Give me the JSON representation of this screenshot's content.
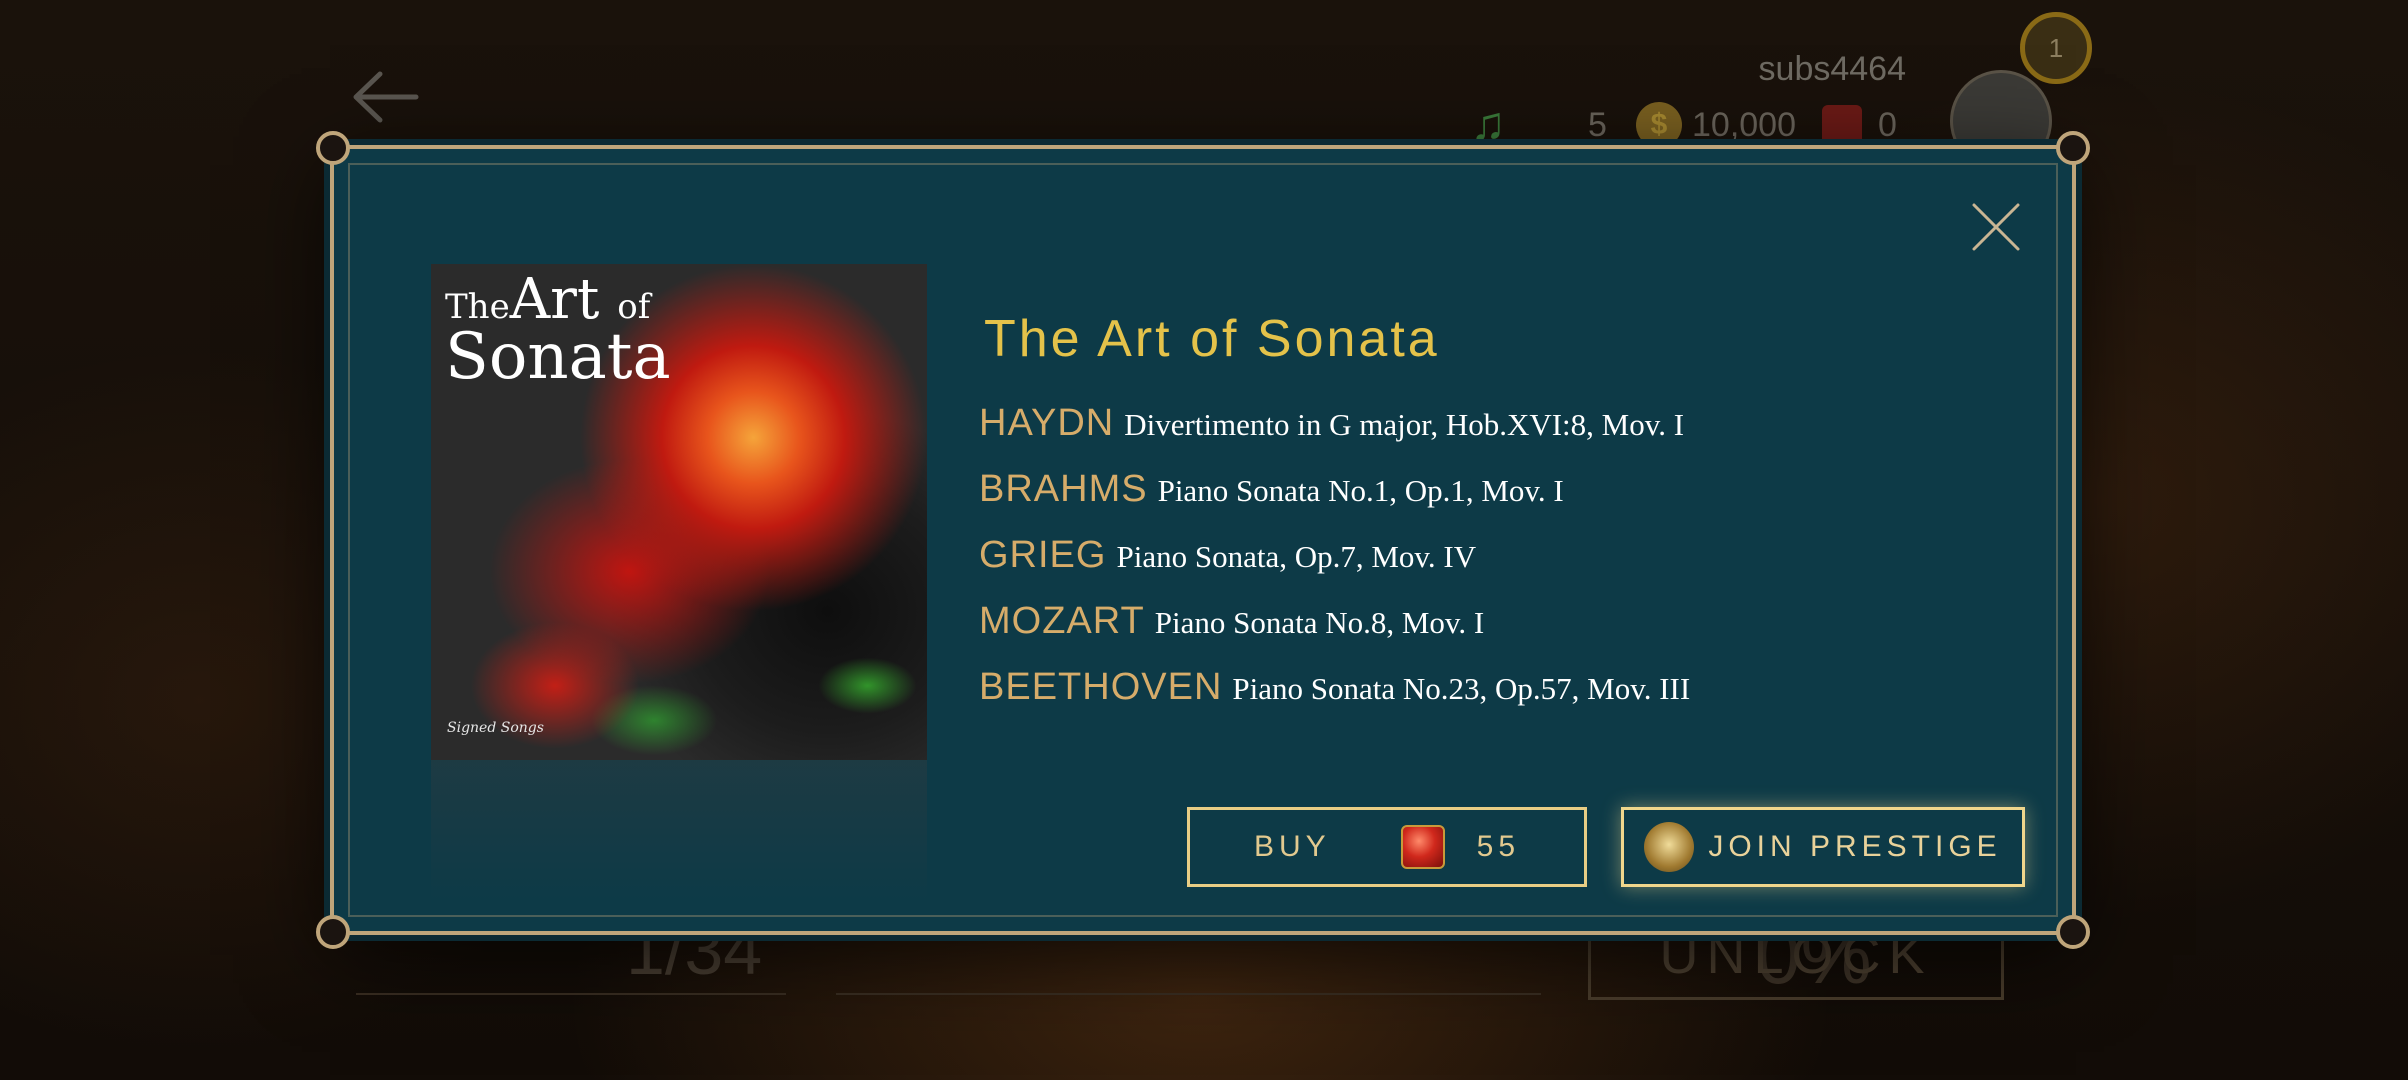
{
  "hud": {
    "username": "subs4464",
    "notes": "5",
    "coins": "10,000",
    "gems": "0",
    "level": "1"
  },
  "background": {
    "pager": "1/34",
    "percent": "0%",
    "unlock_label": "UNLOCK"
  },
  "modal": {
    "cover": {
      "title_the": "The",
      "title_art": "Art",
      "title_of": "of",
      "title_sonata": "Sonata",
      "credit": "Signed Songs"
    },
    "title": "The Art of Sonata",
    "tracks": [
      {
        "composer": "HAYDN",
        "piece": "Divertimento in G major, Hob.XVI:8, Mov. I"
      },
      {
        "composer": "BRAHMS",
        "piece": "Piano Sonata No.1, Op.1, Mov. I"
      },
      {
        "composer": "GRIEG",
        "piece": "Piano Sonata, Op.7, Mov. IV"
      },
      {
        "composer": "MOZART",
        "piece": "Piano Sonata No.8, Mov. I"
      },
      {
        "composer": "BEETHOVEN",
        "piece": "Piano Sonata No.23, Op.57, Mov. III"
      }
    ],
    "buy_label": "BUY",
    "buy_price": "55",
    "prestige_label": "JOIN PRESTIGE"
  },
  "icons": {
    "back": "back-arrow-icon",
    "note": "music-note-icon",
    "coin": "coin-icon",
    "gem": "ruby-gem-icon",
    "close": "close-icon",
    "crest": "prestige-crest-icon"
  },
  "colors": {
    "modal_bg": "#0d3a47",
    "modal_border": "#bfa57a",
    "title": "#e4c24a",
    "composer": "#d6ac6a",
    "button_border": "#e8cd85"
  }
}
